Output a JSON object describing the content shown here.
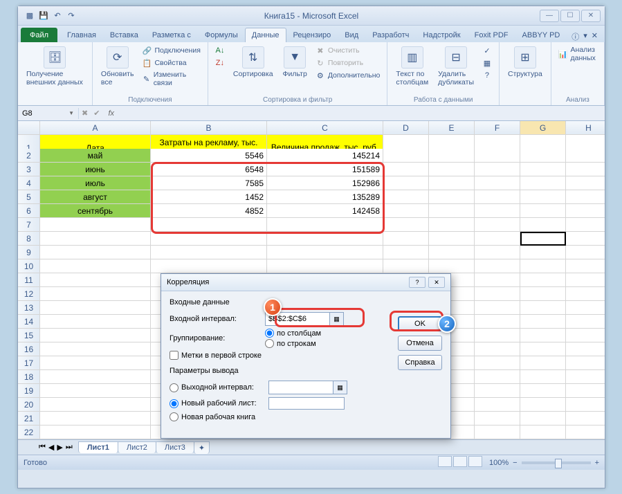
{
  "title": "Книга15 - Microsoft Excel",
  "tabs": {
    "file": "Файл",
    "home": "Главная",
    "insert": "Вставка",
    "layout": "Разметка с",
    "formulas": "Формулы",
    "data": "Данные",
    "review": "Рецензиро",
    "view": "Вид",
    "dev": "Разработч",
    "addins": "Надстройк",
    "foxit": "Foxit PDF",
    "abbyy": "ABBYY PD"
  },
  "ribbon": {
    "g1": {
      "btn": "Получение внешних данных",
      "label": ""
    },
    "g2": {
      "btn": "Обновить все",
      "label": "Подключения",
      "conn": "Подключения",
      "prop": "Свойства",
      "edit": "Изменить связи"
    },
    "g3": {
      "sort": "Сортировка",
      "filter": "Фильтр",
      "label": "Сортировка и фильтр",
      "clear": "Очистить",
      "reapply": "Повторить",
      "adv": "Дополнительно"
    },
    "g4": {
      "ttc": "Текст по столбцам",
      "dup": "Удалить дубликаты",
      "label": "Работа с данными"
    },
    "g5": {
      "struct": "Структура"
    },
    "g6": {
      "analysis": "Анализ данных",
      "label": "Анализ"
    }
  },
  "namebox": "G8",
  "columns": [
    "A",
    "B",
    "C",
    "D",
    "E",
    "F",
    "G",
    "H"
  ],
  "table": {
    "h1": "Дата",
    "h2": "Затраты на рекламу, тыс. руб.",
    "h3": "Величина продаж, тыс. руб.",
    "rows": [
      {
        "a": "май",
        "b": "5546",
        "c": "145214"
      },
      {
        "a": "июнь",
        "b": "6548",
        "c": "151589"
      },
      {
        "a": "июль",
        "b": "7585",
        "c": "152986"
      },
      {
        "a": "август",
        "b": "1452",
        "c": "135289"
      },
      {
        "a": "сентябрь",
        "b": "4852",
        "c": "142458"
      }
    ]
  },
  "dialog": {
    "title": "Корреляция",
    "section1": "Входные данные",
    "inputRange": "Входной интервал:",
    "inputVal": "$B$2:$C$6",
    "grouping": "Группирование:",
    "byCols": "по столбцам",
    "byRows": "по строкам",
    "labels": "Метки в первой строке",
    "section2": "Параметры вывода",
    "outRange": "Выходной интервал:",
    "newWs": "Новый рабочий лист:",
    "newWb": "Новая рабочая книга",
    "ok": "OK",
    "cancel": "Отмена",
    "help": "Справка"
  },
  "callouts": {
    "c1": "1",
    "c2": "2"
  },
  "sheetTabs": [
    "Лист1",
    "Лист2",
    "Лист3"
  ],
  "status": "Готово",
  "zoom": "100%"
}
